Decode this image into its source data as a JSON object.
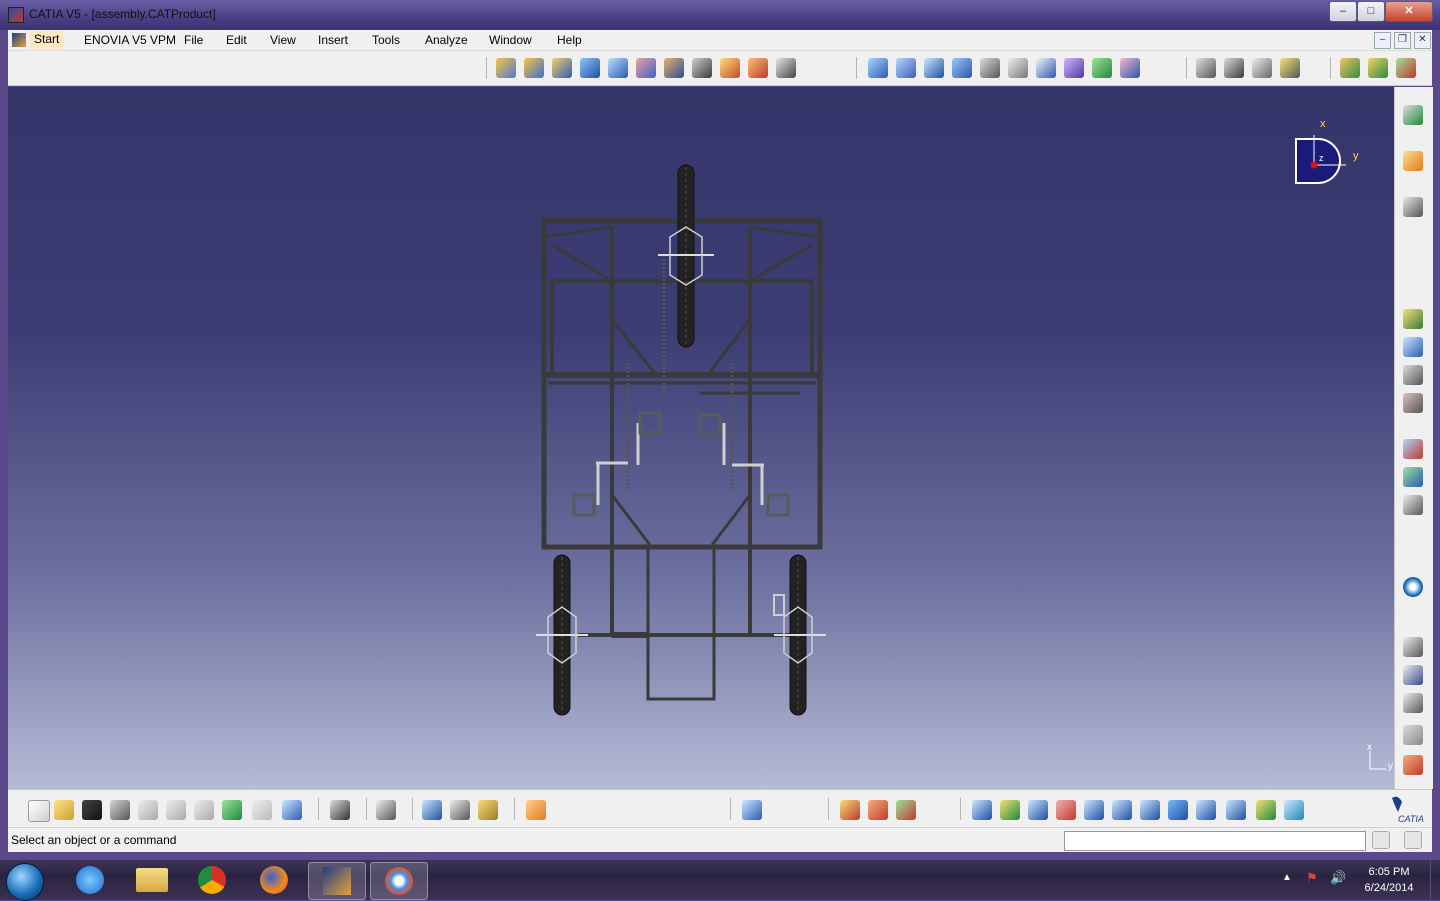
{
  "window": {
    "title": "CATIA V5 - [assembly.CATProduct]"
  },
  "menu": {
    "items": [
      "Start",
      "ENOVIA V5 VPM",
      "File",
      "Edit",
      "View",
      "Insert",
      "Tools",
      "Analyze",
      "Window",
      "Help"
    ]
  },
  "compass": {
    "x_label": "x",
    "y_label": "y",
    "z_label": "z"
  },
  "axis_indicator": {
    "x_label": "x",
    "y_label": "y"
  },
  "branding": {
    "logo_text": "CATIA"
  },
  "status": {
    "message": "Select an object or a command",
    "command_value": ""
  },
  "taskbar": {
    "time": "6:05 PM",
    "date": "6/24/2014"
  },
  "colors": {
    "viewport_top": "#35356a",
    "viewport_bottom": "#b6bcd6",
    "titlebar": "#4a3f85",
    "toolbar_bg": "#f0f0f0",
    "model_frame": "#3a3a3a"
  }
}
